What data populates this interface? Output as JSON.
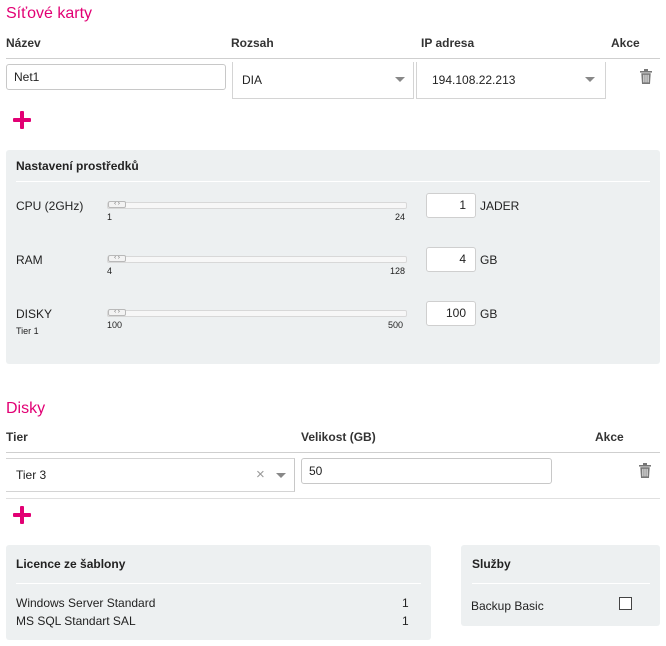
{
  "network": {
    "title": "Síťové karty",
    "headers": {
      "name": "Název",
      "range": "Rozsah",
      "ip": "IP adresa",
      "actions": "Akce"
    },
    "row": {
      "name": "Net1",
      "range": "DIA",
      "ip": "194.108.22.213"
    }
  },
  "resources": {
    "title": "Nastavení prostředků",
    "cpu": {
      "label": "CPU (2GHz)",
      "min": "1",
      "max": "24",
      "value": "1",
      "unit": "JADER",
      "fraction": 0
    },
    "ram": {
      "label": "RAM",
      "min": "4",
      "max": "128",
      "value": "4",
      "unit": "GB",
      "fraction": 0
    },
    "disk": {
      "label": "DISKY",
      "sublabel": "Tier 1",
      "min": "100",
      "max": "500",
      "value": "100",
      "unit": "GB",
      "fraction": 0
    }
  },
  "disks": {
    "title": "Disky",
    "headers": {
      "tier": "Tier",
      "size": "Velikost (GB)",
      "actions": "Akce"
    },
    "row": {
      "tier": "Tier 3",
      "clear": "×",
      "size": "50"
    }
  },
  "licenses": {
    "title": "Licence ze šablony",
    "items": [
      {
        "name": "Windows Server Standard",
        "count": "1"
      },
      {
        "name": "MS SQL Standart SAL",
        "count": "1"
      }
    ]
  },
  "services": {
    "title": "Služby",
    "items": [
      {
        "name": "Backup Basic",
        "checked": false
      }
    ]
  },
  "colors": {
    "accent": "#e20074",
    "panel": "#edf0f1"
  }
}
